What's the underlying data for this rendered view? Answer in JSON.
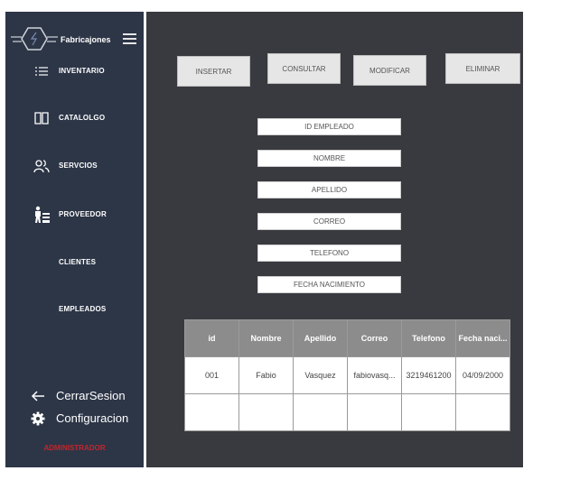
{
  "app": {
    "brand": "Fabricajones",
    "role": "ADMINISTRADOR"
  },
  "sidebar": {
    "items": [
      {
        "label": "INVENTARIO",
        "icon": "list-icon"
      },
      {
        "label": "CATALOLGO",
        "icon": "book-icon"
      },
      {
        "label": "SERVCIOS",
        "icon": "users-icon"
      },
      {
        "label": "PROVEEDOR",
        "icon": "supplier-icon"
      },
      {
        "label": "CLIENTES",
        "icon": ""
      },
      {
        "label": "EMPLEADOS",
        "icon": ""
      }
    ],
    "logout_label": "CerrarSesion",
    "settings_label": "Configuracion"
  },
  "toolbar": {
    "insert_label": "INSERTAR",
    "query_label": "CONSULTAR",
    "modify_label": "MODIFICAR",
    "delete_label": "ELIMINAR"
  },
  "form": {
    "id_label": "ID EMPLEADO",
    "name_label": "NOMBRE",
    "lastname_label": "APELLIDO",
    "email_label": "CORREO",
    "phone_label": "TELEFONO",
    "birth_label": "FECHA NACIMIENTO"
  },
  "table": {
    "headers": [
      "id",
      "Nombre",
      "Apellido",
      "Correo",
      "Telefono",
      "Fecha naci..."
    ],
    "rows": [
      [
        "001",
        "Fabio",
        "Vasquez",
        "fabiovasq...",
        "3219461200",
        "04/09/2000"
      ],
      [
        "",
        "",
        "",
        "",
        "",
        ""
      ]
    ]
  },
  "colors": {
    "sidebar_bg": "#2d3647",
    "main_bg": "#383a3f",
    "role_text": "#c0262d",
    "header_bg": "#8c8c8c"
  }
}
